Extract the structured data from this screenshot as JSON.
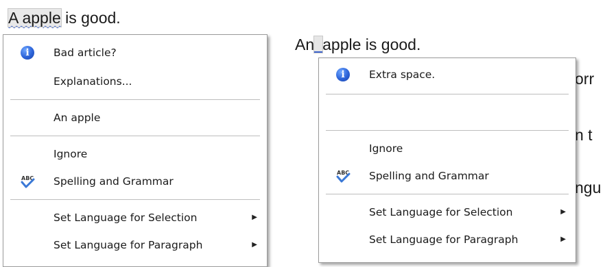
{
  "doc_left": {
    "flagged": "A apple",
    "rest": " is good."
  },
  "doc_right": {
    "prefix": "An",
    "rest": "apple is good.",
    "cut_lines": [
      "orr",
      "n t",
      "ngu"
    ]
  },
  "menu_left": {
    "suggestion_title": "Bad article?",
    "explanations": "Explanations...",
    "replacement": "An apple",
    "ignore": "Ignore",
    "spelling": "Spelling and Grammar",
    "lang_selection": "Set Language for Selection",
    "lang_paragraph": "Set Language for Paragraph"
  },
  "menu_right": {
    "suggestion_title": "Extra space.",
    "ignore": "Ignore",
    "spelling": "Spelling and Grammar",
    "lang_selection": "Set Language for Selection",
    "lang_paragraph": "Set Language for Paragraph"
  },
  "icons": {
    "info": "info-icon",
    "spellcheck": "abc-check-icon",
    "submenu": "triangle-right-icon"
  },
  "colors": {
    "info_blue": "#2c63d8",
    "check_blue": "#3a78d6",
    "wavy_underline": "#4a6fd6"
  }
}
